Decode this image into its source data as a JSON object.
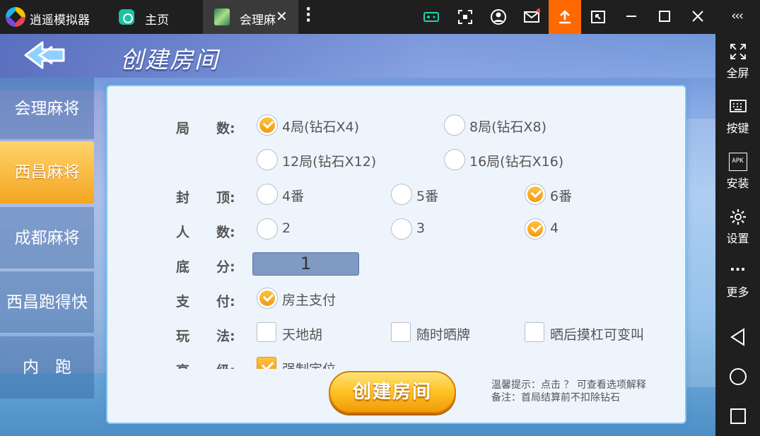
{
  "titlebar": {
    "app_name": "逍遥模拟器",
    "home_label": "主页",
    "tab_label": "会理麻",
    "tab_close": "✕"
  },
  "rightbar": {
    "items": [
      {
        "label": "全屏",
        "icon": "fullscreen-icon"
      },
      {
        "label": "按键",
        "icon": "keyboard-icon"
      },
      {
        "label": "安装",
        "icon": "apk-icon"
      },
      {
        "label": "设置",
        "icon": "gear-icon"
      },
      {
        "label": "更多",
        "icon": "more-icon"
      }
    ],
    "apk_text": "APK",
    "more_dots": "···",
    "collapse": "‹‹‹"
  },
  "game": {
    "title": "创建房间",
    "menu": [
      {
        "label": "会理麻将",
        "active": false
      },
      {
        "label": "西昌麻将",
        "active": true
      },
      {
        "label": "成都麻将",
        "active": false
      },
      {
        "label": "西昌跑得快",
        "active": false
      },
      {
        "label": "内　跑",
        "active": false
      }
    ],
    "rows": {
      "rounds": {
        "label": "局　　数:",
        "options": [
          {
            "label": "4局(钻石X4)",
            "checked": true
          },
          {
            "label": "8局(钻石X8)",
            "checked": false
          },
          {
            "label": "12局(钻石X12)",
            "checked": false
          },
          {
            "label": "16局(钻石X16)",
            "checked": false
          }
        ]
      },
      "cap": {
        "label": "封　　顶:",
        "options": [
          {
            "label": "4番",
            "checked": false
          },
          {
            "label": "5番",
            "checked": false
          },
          {
            "label": "6番",
            "checked": true
          }
        ]
      },
      "players": {
        "label": "人　　数:",
        "options": [
          {
            "label": "2",
            "checked": false
          },
          {
            "label": "3",
            "checked": false
          },
          {
            "label": "4",
            "checked": true
          }
        ]
      },
      "base_score": {
        "label": "底　　分:",
        "value": "1"
      },
      "payment": {
        "label": "支　　付:",
        "options": [
          {
            "label": "房主支付",
            "checked": true
          }
        ]
      },
      "play": {
        "label": "玩　　法:",
        "options": [
          {
            "label": "天地胡",
            "checked": false
          },
          {
            "label": "随时晒牌",
            "checked": false
          },
          {
            "label": "晒后摸杠可变叫",
            "checked": false
          }
        ]
      },
      "advanced": {
        "label": "高　　级:",
        "options": [
          {
            "label": "强制定位",
            "checked": true
          }
        ]
      }
    },
    "create_button": "创建房间",
    "tip_line1": "温馨提示：点击 ？ 可查看选项解释",
    "tip_line2": "备注：首局结算前不扣除钻石"
  }
}
